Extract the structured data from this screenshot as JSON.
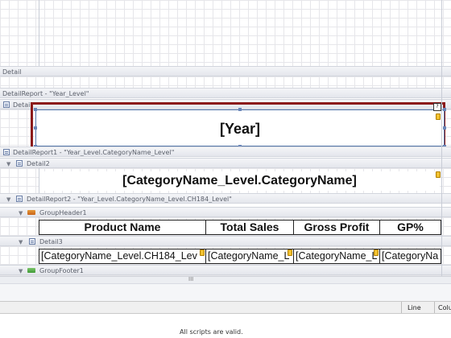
{
  "bands": {
    "detail_top": "Detail",
    "detail_report_year": "DetailReport - \"Year_Level\"",
    "detail_year": "Detail",
    "detail_report1": "DetailReport1 - \"Year_Level.CategoryName_Level\"",
    "detail2": "Detail2",
    "detail_report2": "DetailReport2 - \"Year_Level.CategoryName_Level.CH184_Level\"",
    "group_header1": "GroupHeader1",
    "detail3": "Detail3",
    "group_footer1": "GroupFooter1"
  },
  "labels": {
    "year": "[Year]",
    "category_name": "[CategoryName_Level.CategoryName]"
  },
  "table_header": [
    "Product Name",
    "Total Sales",
    "Gross Profit",
    "GP%"
  ],
  "table_row": [
    "[CategoryName_Level.CH184_Lev",
    "[CategoryName_L",
    "[CategoryName_L",
    "[CategoryNa"
  ],
  "scrollbar": {
    "grip": "III"
  },
  "status_bar": {
    "line_label": "Line",
    "col_label": "Colu"
  },
  "script_status": "All scripts are valid.",
  "icons": {
    "smart_tag": "smart-tag-icon",
    "band": "band-icon"
  },
  "colors": {
    "selection_border": "#8b1a1a",
    "band_background": "#e8eaf0"
  }
}
